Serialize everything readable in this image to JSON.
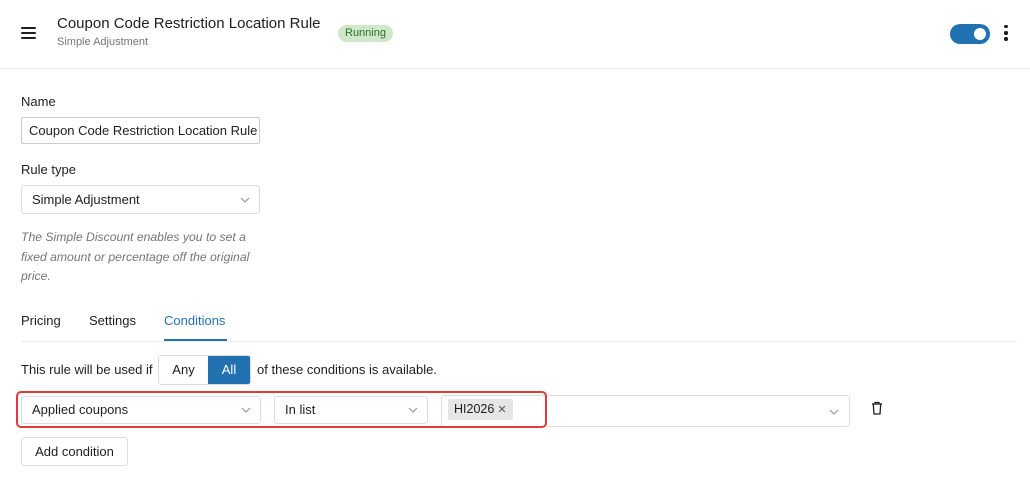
{
  "header": {
    "title": "Coupon Code Restriction Location Rule",
    "subtitle": "Simple Adjustment",
    "status": "Running",
    "enabled": true,
    "colors": {
      "accent": "#2271b1",
      "badge_bg": "#cfe8c7",
      "badge_text": "#2e6d2e"
    }
  },
  "form": {
    "name_label": "Name",
    "name_value": "Coupon Code Restriction Location Rule",
    "rule_type_label": "Rule type",
    "rule_type_value": "Simple Adjustment",
    "help_text": "The Simple Discount enables you to set a fixed amount or percentage off the original price."
  },
  "tabs": [
    {
      "label": "Pricing",
      "active": false
    },
    {
      "label": "Settings",
      "active": false
    },
    {
      "label": "Conditions",
      "active": true
    }
  ],
  "conditions": {
    "prefix": "This rule will be used if",
    "match_options": [
      "Any",
      "All"
    ],
    "match_selected": "All",
    "suffix": "of these conditions is available.",
    "rows": [
      {
        "field": "Applied coupons",
        "operator": "In list",
        "values": [
          "HI2026"
        ]
      }
    ],
    "add_label": "Add condition",
    "highlight_color": "#e03a3a"
  },
  "icons": [
    "menu-icon",
    "toggle-switch",
    "kebab-menu-icon",
    "chevron-down-icon",
    "close-icon",
    "trash-icon"
  ]
}
